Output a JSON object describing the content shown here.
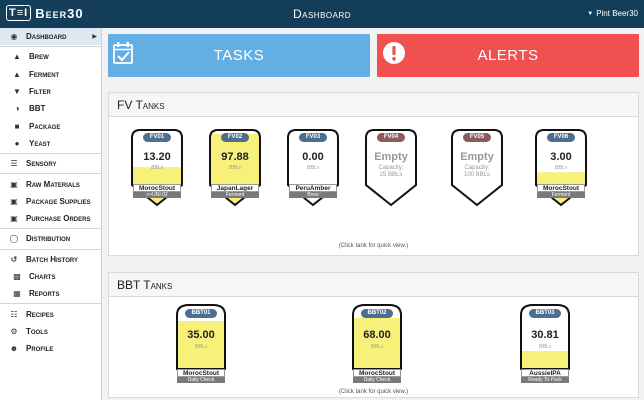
{
  "header": {
    "brand_logo": "T≡I",
    "brand_name": "Beer30",
    "page_title": "Dashboard",
    "user_label": "Pint Beer30"
  },
  "sidebar": {
    "items": [
      {
        "label": "Dashboard",
        "icon": "dashboard-icon",
        "active": true
      },
      {
        "label": "Brew",
        "icon": "flask-icon"
      },
      {
        "label": "Ferment",
        "icon": "flask-icon"
      },
      {
        "label": "Filter",
        "icon": "filter-icon"
      },
      {
        "label": "BBT",
        "icon": "half-circle-icon"
      },
      {
        "label": "Package",
        "icon": "box-icon"
      },
      {
        "label": "Yeast",
        "icon": "yeast-icon"
      },
      {
        "label": "Sensory",
        "icon": "sliders-icon"
      },
      {
        "label": "Raw Materials",
        "icon": "truck-icon"
      },
      {
        "label": "Package Supplies",
        "icon": "truck-icon"
      },
      {
        "label": "Purchase Orders",
        "icon": "truck-icon"
      },
      {
        "label": "Distribution",
        "icon": "globe-icon"
      },
      {
        "label": "Batch History",
        "icon": "history-icon"
      },
      {
        "label": "Charts",
        "icon": "chart-icon"
      },
      {
        "label": "Reports",
        "icon": "report-icon"
      },
      {
        "label": "Recipes",
        "icon": "recipe-icon"
      },
      {
        "label": "Tools",
        "icon": "gear-icon"
      },
      {
        "label": "Profile",
        "icon": "user-icon"
      }
    ]
  },
  "actions": {
    "tasks_label": "TASKS",
    "alerts_label": "ALERTS"
  },
  "fv": {
    "title": "FV Tanks",
    "hint": "(Click tank for quick view.)",
    "tanks": [
      {
        "id": "FV01",
        "value": "13.20",
        "unit": "BBLs",
        "name": "MorocStout",
        "status": ">>UNI 02",
        "fill": 0.35,
        "tag_color": "#4d6f8f",
        "empty": false
      },
      {
        "id": "FV02",
        "value": "97.88",
        "unit": "BBLs",
        "name": "JapanLager",
        "status": "Ferment",
        "fill": 1.0,
        "tag_color": "#4d6f8f",
        "empty": false
      },
      {
        "id": "FV03",
        "value": "0.00",
        "unit": "BBLs",
        "name": "PeruAmber",
        "status": "Brew",
        "fill": 0.0,
        "tag_color": "#4d6f8f",
        "empty": false
      },
      {
        "id": "FV04",
        "value": "Empty",
        "cap_label": "Capacity:",
        "cap_value": "25 BBLs",
        "fill": 0.0,
        "tag_color": "#8a5c5c",
        "empty": true
      },
      {
        "id": "FV05",
        "value": "Empty",
        "cap_label": "Capacity:",
        "cap_value": "100 BBLs",
        "fill": 0.0,
        "tag_color": "#8a5c5c",
        "empty": true
      },
      {
        "id": "FV06",
        "value": "3.00",
        "unit": "BBLs",
        "name": "MorocStout",
        "status": "Ferment",
        "fill": 0.25,
        "tag_color": "#4d6f8f",
        "empty": false
      }
    ]
  },
  "bbt": {
    "title": "BBT Tanks",
    "hint": "(Click tank for quick view.)",
    "tanks": [
      {
        "id": "BBT01",
        "value": "35.00",
        "unit": "BBLs",
        "name": "MorocStout",
        "status": "Daily Check",
        "fill": 0.8
      },
      {
        "id": "BBT02",
        "value": "68.00",
        "unit": "BBLs",
        "name": "MorocStout",
        "status": "Daily Check",
        "fill": 0.85
      },
      {
        "id": "BBT03",
        "value": "30.81",
        "unit": "BBLs",
        "name": "AussieIPA",
        "status": "Ready To Pack",
        "fill": 0.3
      }
    ]
  },
  "colors": {
    "topbar": "#143d59",
    "tasks": "#63afe3",
    "alerts": "#f15050",
    "tank_fill": "#f7f17a"
  }
}
